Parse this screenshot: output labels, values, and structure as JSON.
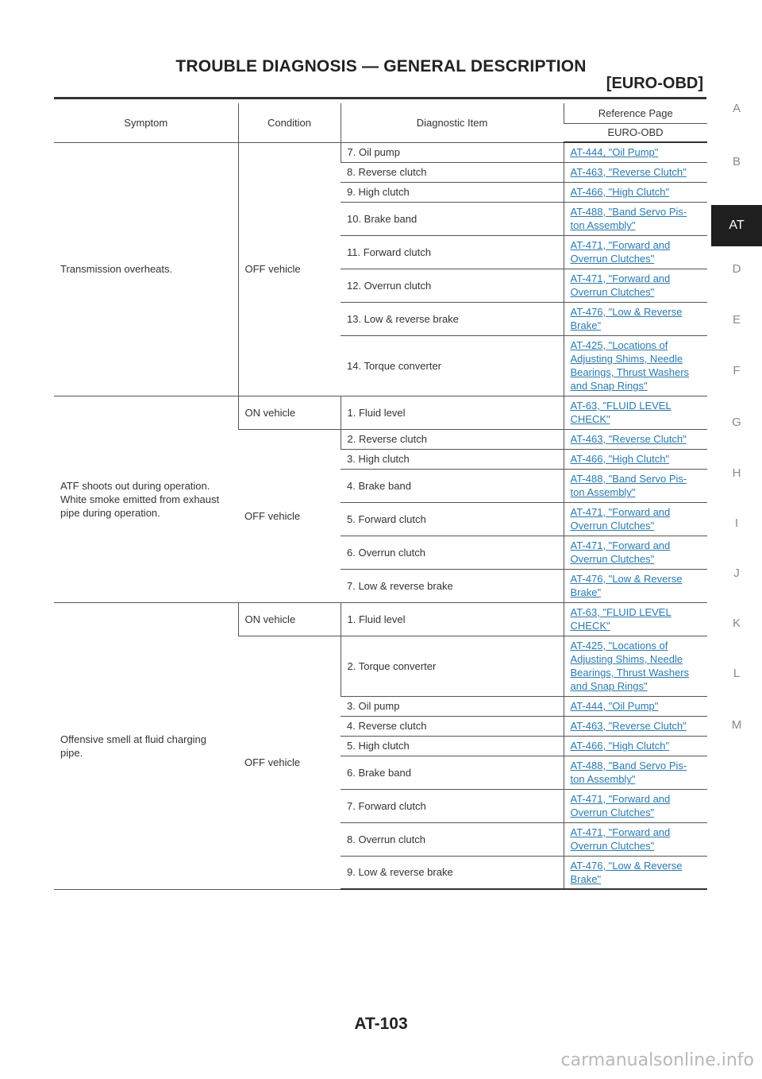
{
  "header": {
    "title": "TROUBLE DIAGNOSIS — GENERAL DESCRIPTION",
    "subtitle": "[EURO-OBD]"
  },
  "side_index": [
    "A",
    "B",
    "AT",
    "D",
    "E",
    "F",
    "G",
    "H",
    "I",
    "J",
    "K",
    "L",
    "M"
  ],
  "side_index_active": "AT",
  "table": {
    "headers": {
      "symptom": "Symptom",
      "condition": "Condition",
      "diagnostic_item": "Diagnostic Item",
      "reference_page": "Reference Page",
      "reference_sub": "EURO-OBD"
    },
    "groups": [
      {
        "symptom": "Transmission overheats.",
        "conditions": [
          {
            "condition": "OFF vehicle",
            "items": [
              {
                "item": "7. Oil pump",
                "ref": "AT-444, \"Oil Pump\""
              },
              {
                "item": "8. Reverse clutch",
                "ref": "AT-463, \"Reverse Clutch\""
              },
              {
                "item": "9. High clutch",
                "ref": "AT-466, \"High Clutch\""
              },
              {
                "item": "10. Brake band",
                "ref": "AT-488, \"Band Servo Pis-\nton Assembly\""
              },
              {
                "item": "11. Forward clutch",
                "ref": "AT-471, \"Forward and \nOverrun Clutches\""
              },
              {
                "item": "12. Overrun clutch",
                "ref": "AT-471, \"Forward and \nOverrun Clutches\""
              },
              {
                "item": "13. Low & reverse brake",
                "ref": "AT-476, \"Low & Reverse \nBrake\""
              },
              {
                "item": "14. Torque converter",
                "ref": "AT-425, \"Locations of \nAdjusting Shims, Needle \nBearings, Thrust Washers \nand Snap Rings\""
              }
            ]
          }
        ]
      },
      {
        "symptom": "ATF shoots out during operation.\nWhite smoke emitted from exhaust pipe during operation.",
        "conditions": [
          {
            "condition": "ON vehicle",
            "items": [
              {
                "item": "1. Fluid level",
                "ref": "AT-63, \"FLUID LEVEL \nCHECK\""
              }
            ]
          },
          {
            "condition": "OFF vehicle",
            "items": [
              {
                "item": "2. Reverse clutch",
                "ref": "AT-463, \"Reverse Clutch\""
              },
              {
                "item": "3. High clutch",
                "ref": "AT-466, \"High Clutch\""
              },
              {
                "item": "4. Brake band",
                "ref": "AT-488, \"Band Servo Pis-\nton Assembly\""
              },
              {
                "item": "5. Forward clutch",
                "ref": "AT-471, \"Forward and \nOverrun Clutches\""
              },
              {
                "item": "6. Overrun clutch",
                "ref": "AT-471, \"Forward and \nOverrun Clutches\""
              },
              {
                "item": "7. Low & reverse brake",
                "ref": "AT-476, \"Low & Reverse \nBrake\""
              }
            ]
          }
        ]
      },
      {
        "symptom": "Offensive smell at fluid charging pipe.",
        "conditions": [
          {
            "condition": "ON vehicle",
            "items": [
              {
                "item": "1. Fluid level",
                "ref": "AT-63, \"FLUID LEVEL \nCHECK\""
              }
            ]
          },
          {
            "condition": "OFF vehicle",
            "items": [
              {
                "item": "2. Torque converter",
                "ref": "AT-425, \"Locations of \nAdjusting Shims, Needle \nBearings, Thrust Washers \nand Snap Rings\""
              },
              {
                "item": "3. Oil pump",
                "ref": "AT-444, \"Oil Pump\""
              },
              {
                "item": "4. Reverse clutch",
                "ref": "AT-463, \"Reverse Clutch\""
              },
              {
                "item": "5. High clutch",
                "ref": "AT-466, \"High Clutch\""
              },
              {
                "item": "6. Brake band",
                "ref": "AT-488, \"Band Servo Pis-\nton Assembly\""
              },
              {
                "item": "7. Forward clutch",
                "ref": "AT-471, \"Forward and \nOverrun Clutches\""
              },
              {
                "item": "8. Overrun clutch",
                "ref": "AT-471, \"Forward and \nOverrun Clutches\""
              },
              {
                "item": "9. Low & reverse brake",
                "ref": "AT-476, \"Low & Reverse \nBrake\""
              }
            ]
          }
        ]
      }
    ]
  },
  "footer": {
    "page_number": "AT-103",
    "watermark": "carmanualsonline.info"
  }
}
